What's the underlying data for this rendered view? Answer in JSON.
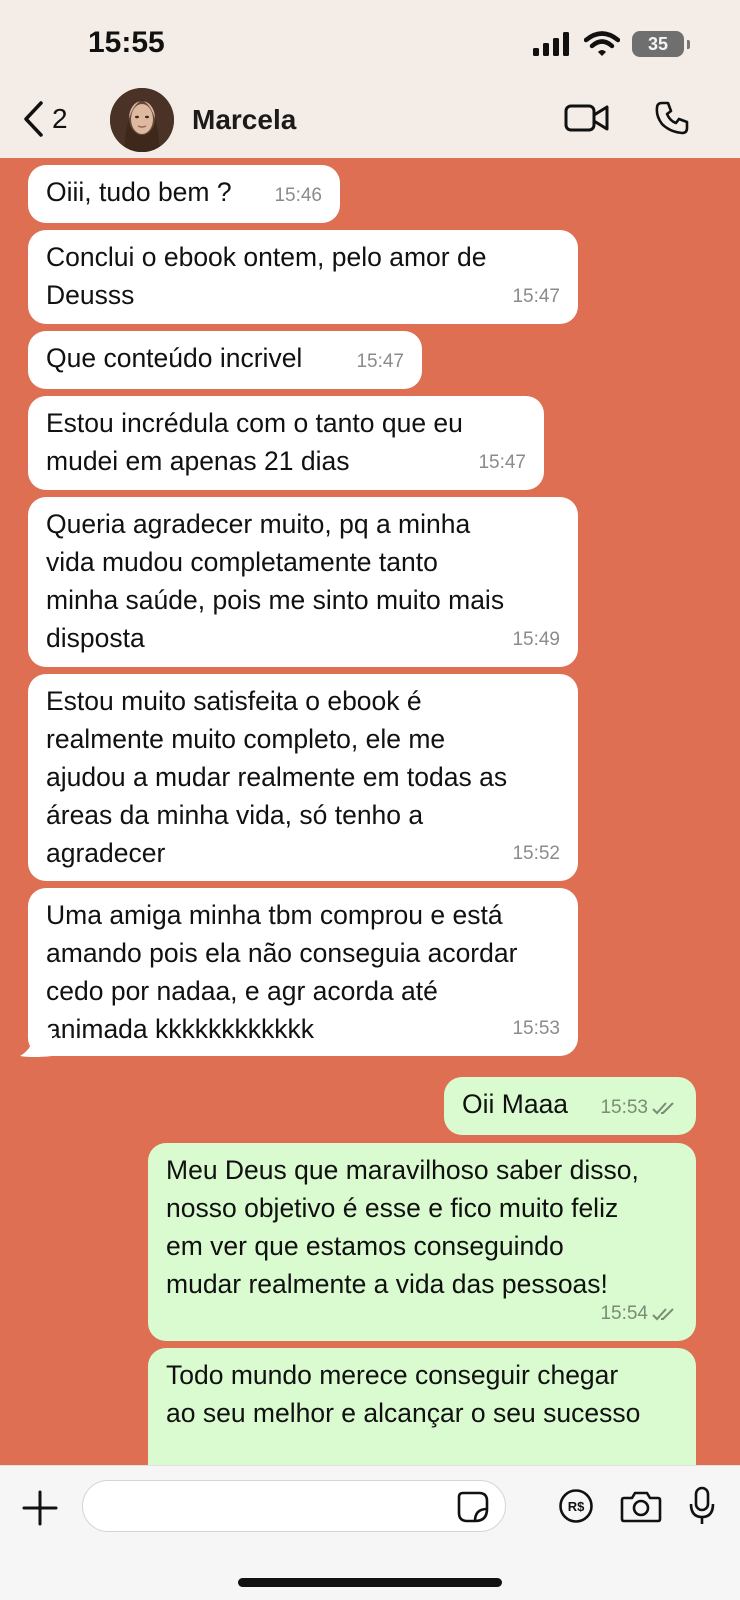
{
  "status": {
    "time": "15:55",
    "battery": "35"
  },
  "header": {
    "back_count": "2",
    "contact_name": "Marcela"
  },
  "messages": [
    {
      "dir": "in",
      "text": "Oiii, tudo bem ?",
      "time": "15:46"
    },
    {
      "dir": "in",
      "text": "Conclui o ebook ontem, pelo amor de\nDeusss",
      "time": "15:47"
    },
    {
      "dir": "in",
      "text": "Que conteúdo incrivel",
      "time": "15:47"
    },
    {
      "dir": "in",
      "text": "Estou incrédula com o tanto que eu\nmudei em apenas 21 dias",
      "time": "15:47"
    },
    {
      "dir": "in",
      "text": "Queria agradecer muito, pq a minha\nvida mudou completamente tanto\nminha saúde, pois me sinto muito mais\ndisposta",
      "time": "15:49"
    },
    {
      "dir": "in",
      "text": "Estou muito satisfeita o ebook é\nrealmente muito completo, ele me\najudou a mudar realmente em todas as\náreas da minha vida, só tenho a\nagradecer",
      "time": "15:52"
    },
    {
      "dir": "in",
      "text": "Uma amiga minha tbm comprou e está\namando pois ela não conseguia acordar\ncedo por nadaa, e agr acorda até\nanimada kkkkkkkkkkkk",
      "time": "15:53"
    },
    {
      "dir": "out",
      "text": "Oii Maaa",
      "time": "15:53"
    },
    {
      "dir": "out",
      "text": "Meu Deus que maravilhoso saber disso,\nnosso objetivo é esse e fico muito feliz\nem ver que estamos conseguindo\nmudar realmente a vida das pessoas!",
      "time": "15:54"
    },
    {
      "dir": "out",
      "text": "Todo mundo merece conseguir chegar\nao seu melhor e alcançar o seu sucesso",
      "time": ""
    }
  ],
  "composer": {
    "placeholder": ""
  },
  "colors": {
    "chat_background": "#de6f52",
    "incoming_bubble": "#ffffff",
    "outgoing_bubble": "#d9fbcf"
  }
}
